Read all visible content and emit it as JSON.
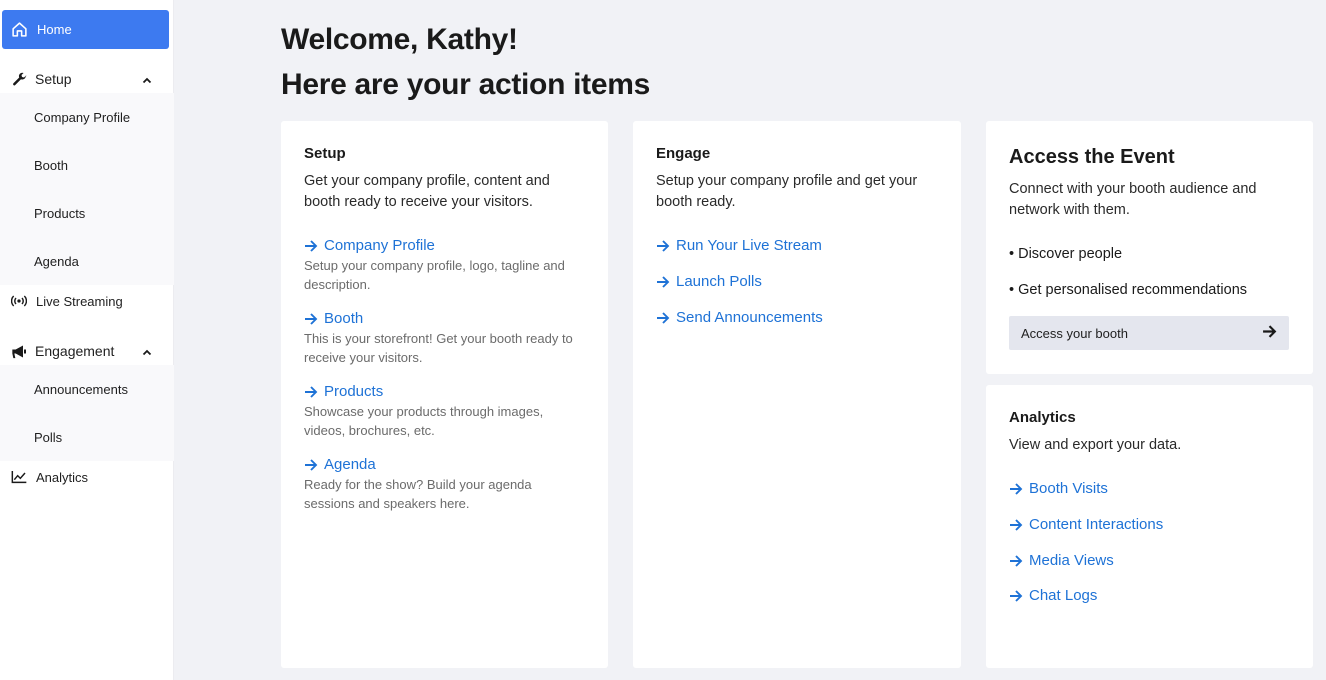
{
  "sidebar": {
    "home": "Home",
    "setup": {
      "label": "Setup",
      "items": [
        "Company Profile",
        "Booth",
        "Products",
        "Agenda"
      ]
    },
    "live_streaming": "Live Streaming",
    "engagement": {
      "label": "Engagement",
      "items": [
        "Announcements",
        "Polls"
      ]
    },
    "analytics": "Analytics"
  },
  "header": {
    "welcome": "Welcome, Kathy!",
    "subtitle": "Here are your action items"
  },
  "setup_card": {
    "title": "Setup",
    "desc": "Get your company profile, content and booth ready to receive your visitors.",
    "links": [
      {
        "label": "Company Profile",
        "desc": "Setup your company profile, logo, tagline and description."
      },
      {
        "label": "Booth",
        "desc": "This is your storefront! Get your booth ready to receive your visitors."
      },
      {
        "label": "Products",
        "desc": "Showcase your products through images, videos, brochures, etc."
      },
      {
        "label": "Agenda",
        "desc": "Ready for the show? Build your agenda sessions and speakers here."
      }
    ]
  },
  "engage_card": {
    "title": "Engage",
    "desc": "Setup your company profile and get your booth ready.",
    "links": [
      "Run Your Live Stream",
      "Launch Polls",
      "Send Announcements"
    ]
  },
  "access_card": {
    "title": "Access the Event",
    "desc": "Connect with your booth audience and network with them.",
    "bullets": [
      "• Discover people",
      "• Get personalised recommendations"
    ],
    "button": "Access your booth"
  },
  "analytics_card": {
    "title": "Analytics",
    "desc": "View and export your data.",
    "links": [
      "Booth Visits",
      "Content Interactions",
      "Media Views",
      "Chat Logs"
    ]
  },
  "colors": {
    "accent": "#3d7af0",
    "link": "#1e72d6",
    "background": "#f1f2f6"
  }
}
